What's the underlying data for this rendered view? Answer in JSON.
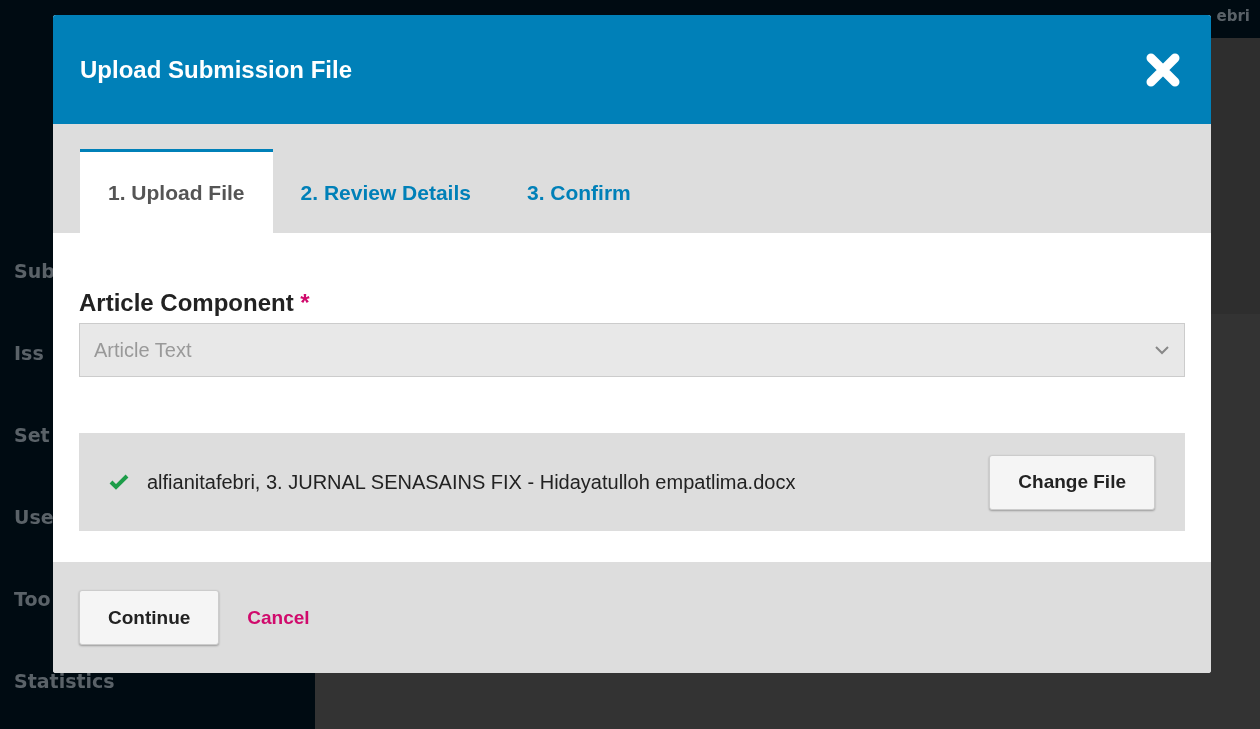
{
  "top_bar": {
    "user": "ebri"
  },
  "sidebar": {
    "items": [
      "Sub",
      "Iss",
      "Set",
      "Use",
      "Too",
      "Statistics"
    ]
  },
  "dialog": {
    "title": "Upload Submission File",
    "tabs": [
      {
        "label": "1. Upload File",
        "selected": true
      },
      {
        "label": "2. Review Details",
        "selected": false
      },
      {
        "label": "3. Confirm",
        "selected": false
      }
    ],
    "component": {
      "label": "Article Component",
      "required_mark": "*",
      "value": "Article Text"
    },
    "file": {
      "uploaded": true,
      "name": "alfianitafebri, 3. JURNAL SENASAINS FIX - Hidayatulloh empatlima.docx",
      "change_button": "Change File"
    },
    "buttons": {
      "continue": "Continue",
      "cancel": "Cancel"
    }
  }
}
